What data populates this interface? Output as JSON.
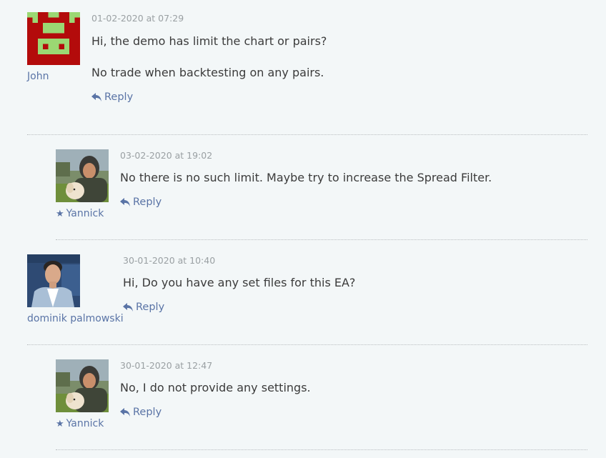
{
  "comments": [
    {
      "author": "John",
      "date": "01-02-2020 at 07:29",
      "paragraphs": [
        "Hi, the demo has limit the chart or pairs?",
        "No trade when backtesting on any pairs."
      ],
      "reply_label": "Reply",
      "is_admin": false,
      "avatar": "identicon-avatar"
    },
    {
      "author": "Yannick",
      "date": "03-02-2020 at 19:02",
      "paragraphs": [
        "No there is no such limit. Maybe try to increase the Spread Filter."
      ],
      "reply_label": "Reply",
      "is_admin": true,
      "avatar": "photo-avatar-man-with-dog"
    },
    {
      "author": "dominik palmowski",
      "date": "30-01-2020 at 10:40",
      "paragraphs": [
        "Hi, Do you have any set files for this EA?"
      ],
      "reply_label": "Reply",
      "is_admin": false,
      "avatar": "photo-avatar-young-man"
    },
    {
      "author": "Yannick",
      "date": "30-01-2020 at 12:47",
      "paragraphs": [
        "No, I do not provide any settings."
      ],
      "reply_label": "Reply",
      "is_admin": true,
      "avatar": "photo-avatar-man-with-dog"
    }
  ],
  "colors": {
    "background": "#f3f7f8",
    "link": "#5a74a6",
    "identicon_bg": "#b30b0b",
    "identicon_fg": "#9bd873"
  },
  "icons": {
    "reply": "reply-arrow-icon",
    "admin": "star-icon"
  }
}
